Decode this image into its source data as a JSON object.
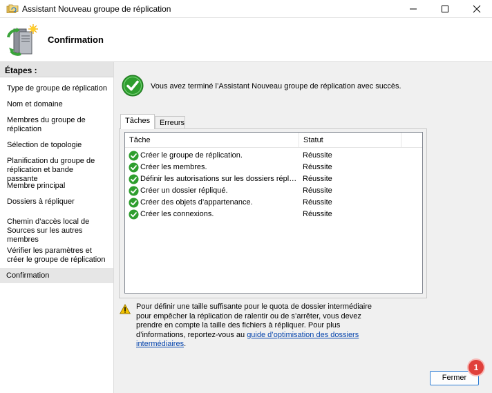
{
  "window": {
    "title": "Assistant Nouveau groupe de réplication",
    "icons": {
      "app": "replication-folder-icon",
      "minimize": "minimize-icon",
      "maximize": "maximize-icon",
      "close": "close-icon"
    }
  },
  "header": {
    "title": "Confirmation",
    "icon": "server-replication-icon"
  },
  "sidebar": {
    "heading": "Étapes :",
    "steps": [
      {
        "label": "Type de groupe de réplication"
      },
      {
        "label": "Nom et domaine"
      },
      {
        "label": "Membres du groupe de réplication"
      },
      {
        "label": "Sélection de topologie"
      },
      {
        "label": "Planification du groupe de réplication et bande passante"
      },
      {
        "label": "Membre principal"
      },
      {
        "label": "Dossiers à répliquer"
      },
      {
        "label": "Chemin d’accès local de Sources sur les autres membres"
      },
      {
        "label": "Vérifier les paramètres et créer le groupe de réplication"
      },
      {
        "label": "Confirmation",
        "active": true
      }
    ]
  },
  "main": {
    "success_message": "Vous avez terminé l’Assistant Nouveau groupe de réplication avec succès.",
    "tabs": [
      {
        "label": "Tâches",
        "selected": true
      },
      {
        "label": "Erreurs",
        "selected": false
      }
    ],
    "table": {
      "columns": [
        "Tâche",
        "Statut"
      ],
      "rows": [
        {
          "task": "Créer le groupe de réplication.",
          "status": "Réussite"
        },
        {
          "task": "Créer les membres.",
          "status": "Réussite"
        },
        {
          "task": "Définir les autorisations sur les dossiers répliqués.",
          "status": "Réussite"
        },
        {
          "task": "Créer un dossier répliqué.",
          "status": "Réussite"
        },
        {
          "task": "Créer des objets d’appartenance.",
          "status": "Réussite"
        },
        {
          "task": "Créer les connexions.",
          "status": "Réussite"
        }
      ]
    },
    "warning": {
      "icon": "warning-icon",
      "text": "Pour définir une taille suffisante pour le quota de dossier intermédiaire pour empêcher la réplication de ralentir ou de s’arrêter, vous devez prendre en compte la taille des fichiers à répliquer. Pour plus d’informations, reportez-vous au ",
      "link": "guide d’optimisation des dossiers intermédiaires",
      "suffix": "."
    }
  },
  "footer": {
    "close_label": "Fermer",
    "badge": "1"
  },
  "colors": {
    "accent": "#2b7bd3",
    "success": "#2e9e2e",
    "warning": "#f2c200",
    "badge": "#e0403b",
    "link": "#0645ad"
  }
}
